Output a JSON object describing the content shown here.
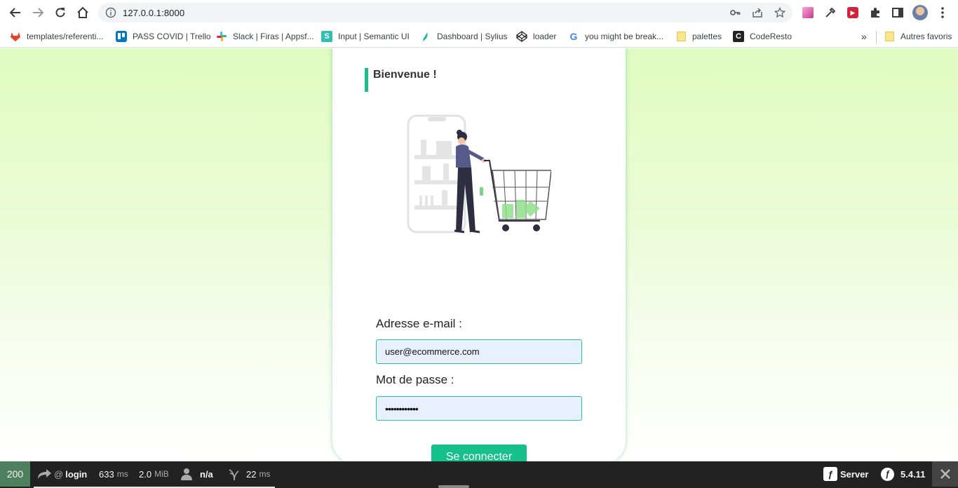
{
  "browser": {
    "url": "127.0.0.1:8000",
    "bookmarks": [
      {
        "label": "templates/referenti...",
        "icon": "gitlab-icon"
      },
      {
        "label": "PASS COVID | Trello",
        "icon": "trello-icon"
      },
      {
        "label": "Slack | Firas | Appsf...",
        "icon": "slack-icon"
      },
      {
        "label": "Input | Semantic UI",
        "icon": "semantic-ui-icon"
      },
      {
        "label": "Dashboard | Sylius",
        "icon": "sylius-icon"
      },
      {
        "label": "loader",
        "icon": "codepen-icon"
      },
      {
        "label": "you might be break...",
        "icon": "google-icon"
      },
      {
        "label": "palettes",
        "icon": "folder-icon"
      },
      {
        "label": "CodeResto",
        "icon": "coderesto-icon"
      }
    ],
    "other_bookmarks": "Autres favoris",
    "overflow": "»"
  },
  "login": {
    "welcome": "Bienvenue !",
    "email_label": "Adresse e-mail :",
    "email_value": "user@ecommerce.com",
    "password_label": "Mot de passe :",
    "password_value": "••••••••••••",
    "submit_label": "Se connecter",
    "accent_color": "#16c08a"
  },
  "symfony_toolbar": {
    "status": "200",
    "route_prefix": "@",
    "route": "login",
    "time_value": "633",
    "time_unit": "ms",
    "memory_value": "2.0",
    "memory_unit": "MiB",
    "user": "n/a",
    "twig_value": "22",
    "twig_unit": "ms",
    "server_label": "Server",
    "version": "5.4.11"
  }
}
